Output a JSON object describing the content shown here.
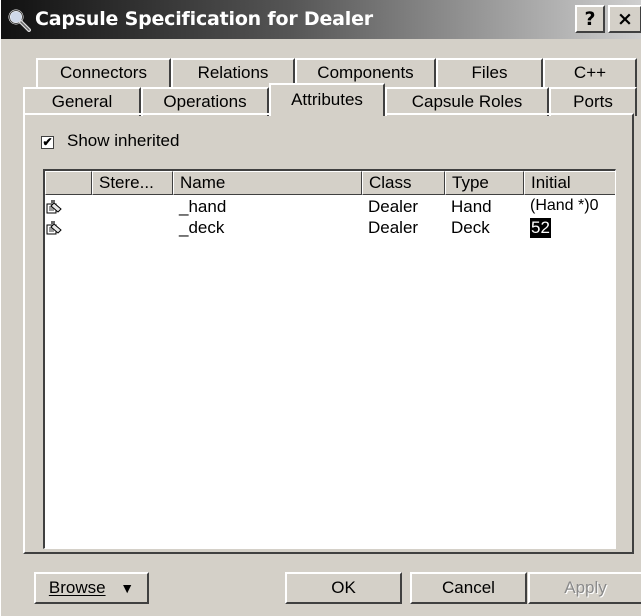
{
  "window": {
    "title": "Capsule Specification for Dealer",
    "help_label": "?",
    "close_label": "×"
  },
  "tabs_row1": [
    {
      "label": "Connectors"
    },
    {
      "label": "Relations"
    },
    {
      "label": "Components"
    },
    {
      "label": "Files"
    },
    {
      "label": "C++"
    }
  ],
  "tabs_row2": [
    {
      "label": "General"
    },
    {
      "label": "Operations"
    },
    {
      "label": "Attributes",
      "active": true
    },
    {
      "label": "Capsule Roles"
    },
    {
      "label": "Ports"
    }
  ],
  "show_inherited": {
    "label": "Show inherited",
    "checked": true,
    "mark": "✔"
  },
  "table": {
    "columns": [
      "",
      "Stere...",
      "Name",
      "Class",
      "Type",
      "Initial"
    ],
    "rows": [
      {
        "icon": "attribute-icon",
        "stereotype": "",
        "name": "_hand",
        "class": "Dealer",
        "type": "Hand",
        "initial": "(Hand *)0"
      },
      {
        "icon": "attribute-icon",
        "stereotype": "",
        "name": "_deck",
        "class": "Dealer",
        "type": "Deck",
        "initial": "52"
      }
    ]
  },
  "buttons": {
    "browse": "Browse",
    "browse_arrow": "▼",
    "ok": "OK",
    "cancel": "Cancel",
    "apply": "Apply"
  }
}
